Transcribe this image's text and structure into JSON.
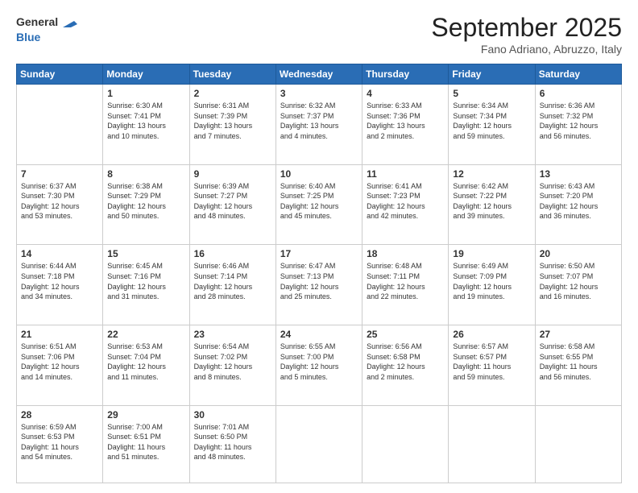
{
  "header": {
    "logo_line1": "General",
    "logo_line2": "Blue",
    "month": "September 2025",
    "location": "Fano Adriano, Abruzzo, Italy"
  },
  "weekdays": [
    "Sunday",
    "Monday",
    "Tuesday",
    "Wednesday",
    "Thursday",
    "Friday",
    "Saturday"
  ],
  "weeks": [
    [
      {
        "day": "",
        "lines": []
      },
      {
        "day": "1",
        "lines": [
          "Sunrise: 6:30 AM",
          "Sunset: 7:41 PM",
          "Daylight: 13 hours",
          "and 10 minutes."
        ]
      },
      {
        "day": "2",
        "lines": [
          "Sunrise: 6:31 AM",
          "Sunset: 7:39 PM",
          "Daylight: 13 hours",
          "and 7 minutes."
        ]
      },
      {
        "day": "3",
        "lines": [
          "Sunrise: 6:32 AM",
          "Sunset: 7:37 PM",
          "Daylight: 13 hours",
          "and 4 minutes."
        ]
      },
      {
        "day": "4",
        "lines": [
          "Sunrise: 6:33 AM",
          "Sunset: 7:36 PM",
          "Daylight: 13 hours",
          "and 2 minutes."
        ]
      },
      {
        "day": "5",
        "lines": [
          "Sunrise: 6:34 AM",
          "Sunset: 7:34 PM",
          "Daylight: 12 hours",
          "and 59 minutes."
        ]
      },
      {
        "day": "6",
        "lines": [
          "Sunrise: 6:36 AM",
          "Sunset: 7:32 PM",
          "Daylight: 12 hours",
          "and 56 minutes."
        ]
      }
    ],
    [
      {
        "day": "7",
        "lines": [
          "Sunrise: 6:37 AM",
          "Sunset: 7:30 PM",
          "Daylight: 12 hours",
          "and 53 minutes."
        ]
      },
      {
        "day": "8",
        "lines": [
          "Sunrise: 6:38 AM",
          "Sunset: 7:29 PM",
          "Daylight: 12 hours",
          "and 50 minutes."
        ]
      },
      {
        "day": "9",
        "lines": [
          "Sunrise: 6:39 AM",
          "Sunset: 7:27 PM",
          "Daylight: 12 hours",
          "and 48 minutes."
        ]
      },
      {
        "day": "10",
        "lines": [
          "Sunrise: 6:40 AM",
          "Sunset: 7:25 PM",
          "Daylight: 12 hours",
          "and 45 minutes."
        ]
      },
      {
        "day": "11",
        "lines": [
          "Sunrise: 6:41 AM",
          "Sunset: 7:23 PM",
          "Daylight: 12 hours",
          "and 42 minutes."
        ]
      },
      {
        "day": "12",
        "lines": [
          "Sunrise: 6:42 AM",
          "Sunset: 7:22 PM",
          "Daylight: 12 hours",
          "and 39 minutes."
        ]
      },
      {
        "day": "13",
        "lines": [
          "Sunrise: 6:43 AM",
          "Sunset: 7:20 PM",
          "Daylight: 12 hours",
          "and 36 minutes."
        ]
      }
    ],
    [
      {
        "day": "14",
        "lines": [
          "Sunrise: 6:44 AM",
          "Sunset: 7:18 PM",
          "Daylight: 12 hours",
          "and 34 minutes."
        ]
      },
      {
        "day": "15",
        "lines": [
          "Sunrise: 6:45 AM",
          "Sunset: 7:16 PM",
          "Daylight: 12 hours",
          "and 31 minutes."
        ]
      },
      {
        "day": "16",
        "lines": [
          "Sunrise: 6:46 AM",
          "Sunset: 7:14 PM",
          "Daylight: 12 hours",
          "and 28 minutes."
        ]
      },
      {
        "day": "17",
        "lines": [
          "Sunrise: 6:47 AM",
          "Sunset: 7:13 PM",
          "Daylight: 12 hours",
          "and 25 minutes."
        ]
      },
      {
        "day": "18",
        "lines": [
          "Sunrise: 6:48 AM",
          "Sunset: 7:11 PM",
          "Daylight: 12 hours",
          "and 22 minutes."
        ]
      },
      {
        "day": "19",
        "lines": [
          "Sunrise: 6:49 AM",
          "Sunset: 7:09 PM",
          "Daylight: 12 hours",
          "and 19 minutes."
        ]
      },
      {
        "day": "20",
        "lines": [
          "Sunrise: 6:50 AM",
          "Sunset: 7:07 PM",
          "Daylight: 12 hours",
          "and 16 minutes."
        ]
      }
    ],
    [
      {
        "day": "21",
        "lines": [
          "Sunrise: 6:51 AM",
          "Sunset: 7:06 PM",
          "Daylight: 12 hours",
          "and 14 minutes."
        ]
      },
      {
        "day": "22",
        "lines": [
          "Sunrise: 6:53 AM",
          "Sunset: 7:04 PM",
          "Daylight: 12 hours",
          "and 11 minutes."
        ]
      },
      {
        "day": "23",
        "lines": [
          "Sunrise: 6:54 AM",
          "Sunset: 7:02 PM",
          "Daylight: 12 hours",
          "and 8 minutes."
        ]
      },
      {
        "day": "24",
        "lines": [
          "Sunrise: 6:55 AM",
          "Sunset: 7:00 PM",
          "Daylight: 12 hours",
          "and 5 minutes."
        ]
      },
      {
        "day": "25",
        "lines": [
          "Sunrise: 6:56 AM",
          "Sunset: 6:58 PM",
          "Daylight: 12 hours",
          "and 2 minutes."
        ]
      },
      {
        "day": "26",
        "lines": [
          "Sunrise: 6:57 AM",
          "Sunset: 6:57 PM",
          "Daylight: 11 hours",
          "and 59 minutes."
        ]
      },
      {
        "day": "27",
        "lines": [
          "Sunrise: 6:58 AM",
          "Sunset: 6:55 PM",
          "Daylight: 11 hours",
          "and 56 minutes."
        ]
      }
    ],
    [
      {
        "day": "28",
        "lines": [
          "Sunrise: 6:59 AM",
          "Sunset: 6:53 PM",
          "Daylight: 11 hours",
          "and 54 minutes."
        ]
      },
      {
        "day": "29",
        "lines": [
          "Sunrise: 7:00 AM",
          "Sunset: 6:51 PM",
          "Daylight: 11 hours",
          "and 51 minutes."
        ]
      },
      {
        "day": "30",
        "lines": [
          "Sunrise: 7:01 AM",
          "Sunset: 6:50 PM",
          "Daylight: 11 hours",
          "and 48 minutes."
        ]
      },
      {
        "day": "",
        "lines": []
      },
      {
        "day": "",
        "lines": []
      },
      {
        "day": "",
        "lines": []
      },
      {
        "day": "",
        "lines": []
      }
    ]
  ]
}
